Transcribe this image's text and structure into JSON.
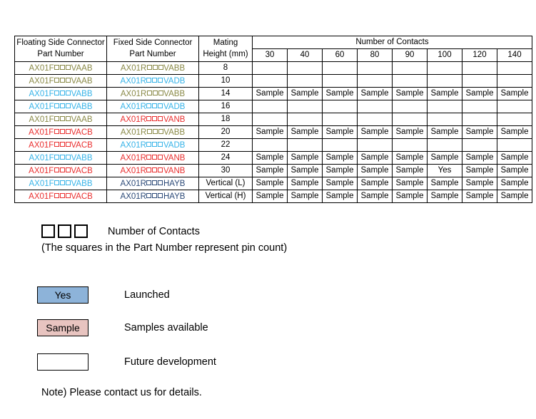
{
  "table": {
    "headers": {
      "floating_line1": "Floating Side Connector",
      "floating_line2": "Part Number",
      "fixed_line1": "Fixed Side Connector",
      "fixed_line2": "Part Number",
      "mating_line1": "Mating",
      "mating_line2": "Height (mm)",
      "contacts_group": "Number of Contacts"
    },
    "contact_counts": [
      "30",
      "40",
      "60",
      "80",
      "90",
      "100",
      "120",
      "140"
    ],
    "status_labels": {
      "sample": "Sample",
      "yes": "Yes",
      "empty": ""
    },
    "colors": {
      "olive": "#8a8a48",
      "cyan": "#36b3e8",
      "red": "#ea2f2f",
      "navy": "#2c4a78",
      "sample_bg": "#e8c4c0",
      "yes_bg": "#8db3d9",
      "border": "#000000"
    },
    "rows": [
      {
        "floating_prefix": "AX01F",
        "floating_suffix": "VAAB",
        "floating_color": "olive",
        "fixed_prefix": "AX01R",
        "fixed_suffix": "VABB",
        "fixed_color": "olive",
        "mating_height": "8",
        "status": [
          "empty",
          "empty",
          "empty",
          "empty",
          "empty",
          "empty",
          "empty",
          "empty"
        ]
      },
      {
        "floating_prefix": "AX01F",
        "floating_suffix": "VAAB",
        "floating_color": "olive",
        "fixed_prefix": "AX01R",
        "fixed_suffix": "VADB",
        "fixed_color": "cyan",
        "mating_height": "10",
        "status": [
          "empty",
          "empty",
          "empty",
          "empty",
          "empty",
          "empty",
          "empty",
          "empty"
        ]
      },
      {
        "floating_prefix": "AX01F",
        "floating_suffix": "VABB",
        "floating_color": "cyan",
        "fixed_prefix": "AX01R",
        "fixed_suffix": "VABB",
        "fixed_color": "olive",
        "mating_height": "14",
        "status": [
          "sample",
          "sample",
          "sample",
          "sample",
          "sample",
          "sample",
          "sample",
          "sample"
        ]
      },
      {
        "floating_prefix": "AX01F",
        "floating_suffix": "VABB",
        "floating_color": "cyan",
        "fixed_prefix": "AX01R",
        "fixed_suffix": "VADB",
        "fixed_color": "cyan",
        "mating_height": "16",
        "status": [
          "empty",
          "empty",
          "empty",
          "empty",
          "empty",
          "empty",
          "empty",
          "empty"
        ]
      },
      {
        "floating_prefix": "AX01F",
        "floating_suffix": "VAAB",
        "floating_color": "olive",
        "fixed_prefix": "AX01R",
        "fixed_suffix": "VANB",
        "fixed_color": "red",
        "mating_height": "18",
        "status": [
          "empty",
          "empty",
          "empty",
          "empty",
          "empty",
          "empty",
          "empty",
          "empty"
        ]
      },
      {
        "floating_prefix": "AX01F",
        "floating_suffix": "VACB",
        "floating_color": "red",
        "fixed_prefix": "AX01R",
        "fixed_suffix": "VABB",
        "fixed_color": "olive",
        "mating_height": "20",
        "status": [
          "sample",
          "sample",
          "sample",
          "sample",
          "sample",
          "sample",
          "sample",
          "sample"
        ]
      },
      {
        "floating_prefix": "AX01F",
        "floating_suffix": "VACB",
        "floating_color": "red",
        "fixed_prefix": "AX01R",
        "fixed_suffix": "VADB",
        "fixed_color": "cyan",
        "mating_height": "22",
        "status": [
          "empty",
          "empty",
          "empty",
          "empty",
          "empty",
          "empty",
          "empty",
          "empty"
        ]
      },
      {
        "floating_prefix": "AX01F",
        "floating_suffix": "VABB",
        "floating_color": "cyan",
        "fixed_prefix": "AX01R",
        "fixed_suffix": "VANB",
        "fixed_color": "red",
        "mating_height": "24",
        "status": [
          "sample",
          "sample",
          "sample",
          "sample",
          "sample",
          "sample",
          "sample",
          "sample"
        ]
      },
      {
        "floating_prefix": "AX01F",
        "floating_suffix": "VACB",
        "floating_color": "red",
        "fixed_prefix": "AX01R",
        "fixed_suffix": "VANB",
        "fixed_color": "red",
        "mating_height": "30",
        "status": [
          "sample",
          "sample",
          "sample",
          "sample",
          "sample",
          "yes",
          "sample",
          "sample"
        ]
      },
      {
        "floating_prefix": "AX01F",
        "floating_suffix": "VABB",
        "floating_color": "cyan",
        "fixed_prefix": "AX01R",
        "fixed_suffix": "HAYB",
        "fixed_color": "navy",
        "mating_height": "Vertical (L)",
        "status": [
          "sample",
          "sample",
          "sample",
          "sample",
          "sample",
          "sample",
          "sample",
          "sample"
        ]
      },
      {
        "floating_prefix": "AX01F",
        "floating_suffix": "VACB",
        "floating_color": "red",
        "fixed_prefix": "AX01R",
        "fixed_suffix": "HAYB",
        "fixed_color": "navy",
        "mating_height": "Vertical (H)",
        "status": [
          "sample",
          "sample",
          "sample",
          "sample",
          "sample",
          "sample",
          "sample",
          "sample"
        ]
      }
    ]
  },
  "legend": {
    "squares_label": "Number of Contacts",
    "squares_note": "(The squares in the Part Number represent pin count)",
    "items": [
      {
        "box_label": "Yes",
        "style": "yes",
        "description": "Launched"
      },
      {
        "box_label": "Sample",
        "style": "sample",
        "description": "Samples available"
      },
      {
        "box_label": "",
        "style": "future",
        "description": "Future development"
      }
    ],
    "footer_note": "Note) Please contact us for details."
  }
}
